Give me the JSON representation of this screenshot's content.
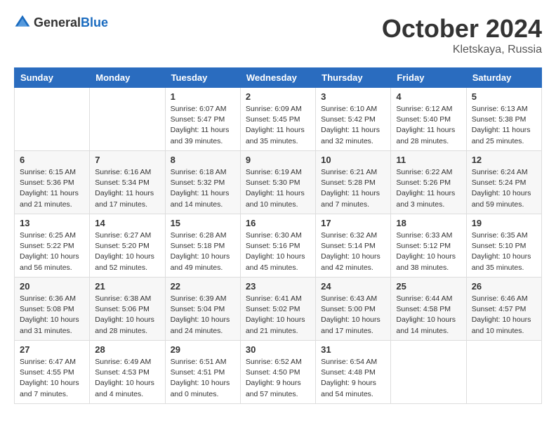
{
  "header": {
    "logo": {
      "general": "General",
      "blue": "Blue"
    },
    "month": "October 2024",
    "location": "Kletskaya, Russia"
  },
  "weekdays": [
    "Sunday",
    "Monday",
    "Tuesday",
    "Wednesday",
    "Thursday",
    "Friday",
    "Saturday"
  ],
  "weeks": [
    [
      {
        "day": "",
        "info": ""
      },
      {
        "day": "",
        "info": ""
      },
      {
        "day": "1",
        "info": "Sunrise: 6:07 AM\nSunset: 5:47 PM\nDaylight: 11 hours and 39 minutes."
      },
      {
        "day": "2",
        "info": "Sunrise: 6:09 AM\nSunset: 5:45 PM\nDaylight: 11 hours and 35 minutes."
      },
      {
        "day": "3",
        "info": "Sunrise: 6:10 AM\nSunset: 5:42 PM\nDaylight: 11 hours and 32 minutes."
      },
      {
        "day": "4",
        "info": "Sunrise: 6:12 AM\nSunset: 5:40 PM\nDaylight: 11 hours and 28 minutes."
      },
      {
        "day": "5",
        "info": "Sunrise: 6:13 AM\nSunset: 5:38 PM\nDaylight: 11 hours and 25 minutes."
      }
    ],
    [
      {
        "day": "6",
        "info": "Sunrise: 6:15 AM\nSunset: 5:36 PM\nDaylight: 11 hours and 21 minutes."
      },
      {
        "day": "7",
        "info": "Sunrise: 6:16 AM\nSunset: 5:34 PM\nDaylight: 11 hours and 17 minutes."
      },
      {
        "day": "8",
        "info": "Sunrise: 6:18 AM\nSunset: 5:32 PM\nDaylight: 11 hours and 14 minutes."
      },
      {
        "day": "9",
        "info": "Sunrise: 6:19 AM\nSunset: 5:30 PM\nDaylight: 11 hours and 10 minutes."
      },
      {
        "day": "10",
        "info": "Sunrise: 6:21 AM\nSunset: 5:28 PM\nDaylight: 11 hours and 7 minutes."
      },
      {
        "day": "11",
        "info": "Sunrise: 6:22 AM\nSunset: 5:26 PM\nDaylight: 11 hours and 3 minutes."
      },
      {
        "day": "12",
        "info": "Sunrise: 6:24 AM\nSunset: 5:24 PM\nDaylight: 10 hours and 59 minutes."
      }
    ],
    [
      {
        "day": "13",
        "info": "Sunrise: 6:25 AM\nSunset: 5:22 PM\nDaylight: 10 hours and 56 minutes."
      },
      {
        "day": "14",
        "info": "Sunrise: 6:27 AM\nSunset: 5:20 PM\nDaylight: 10 hours and 52 minutes."
      },
      {
        "day": "15",
        "info": "Sunrise: 6:28 AM\nSunset: 5:18 PM\nDaylight: 10 hours and 49 minutes."
      },
      {
        "day": "16",
        "info": "Sunrise: 6:30 AM\nSunset: 5:16 PM\nDaylight: 10 hours and 45 minutes."
      },
      {
        "day": "17",
        "info": "Sunrise: 6:32 AM\nSunset: 5:14 PM\nDaylight: 10 hours and 42 minutes."
      },
      {
        "day": "18",
        "info": "Sunrise: 6:33 AM\nSunset: 5:12 PM\nDaylight: 10 hours and 38 minutes."
      },
      {
        "day": "19",
        "info": "Sunrise: 6:35 AM\nSunset: 5:10 PM\nDaylight: 10 hours and 35 minutes."
      }
    ],
    [
      {
        "day": "20",
        "info": "Sunrise: 6:36 AM\nSunset: 5:08 PM\nDaylight: 10 hours and 31 minutes."
      },
      {
        "day": "21",
        "info": "Sunrise: 6:38 AM\nSunset: 5:06 PM\nDaylight: 10 hours and 28 minutes."
      },
      {
        "day": "22",
        "info": "Sunrise: 6:39 AM\nSunset: 5:04 PM\nDaylight: 10 hours and 24 minutes."
      },
      {
        "day": "23",
        "info": "Sunrise: 6:41 AM\nSunset: 5:02 PM\nDaylight: 10 hours and 21 minutes."
      },
      {
        "day": "24",
        "info": "Sunrise: 6:43 AM\nSunset: 5:00 PM\nDaylight: 10 hours and 17 minutes."
      },
      {
        "day": "25",
        "info": "Sunrise: 6:44 AM\nSunset: 4:58 PM\nDaylight: 10 hours and 14 minutes."
      },
      {
        "day": "26",
        "info": "Sunrise: 6:46 AM\nSunset: 4:57 PM\nDaylight: 10 hours and 10 minutes."
      }
    ],
    [
      {
        "day": "27",
        "info": "Sunrise: 6:47 AM\nSunset: 4:55 PM\nDaylight: 10 hours and 7 minutes."
      },
      {
        "day": "28",
        "info": "Sunrise: 6:49 AM\nSunset: 4:53 PM\nDaylight: 10 hours and 4 minutes."
      },
      {
        "day": "29",
        "info": "Sunrise: 6:51 AM\nSunset: 4:51 PM\nDaylight: 10 hours and 0 minutes."
      },
      {
        "day": "30",
        "info": "Sunrise: 6:52 AM\nSunset: 4:50 PM\nDaylight: 9 hours and 57 minutes."
      },
      {
        "day": "31",
        "info": "Sunrise: 6:54 AM\nSunset: 4:48 PM\nDaylight: 9 hours and 54 minutes."
      },
      {
        "day": "",
        "info": ""
      },
      {
        "day": "",
        "info": ""
      }
    ]
  ]
}
